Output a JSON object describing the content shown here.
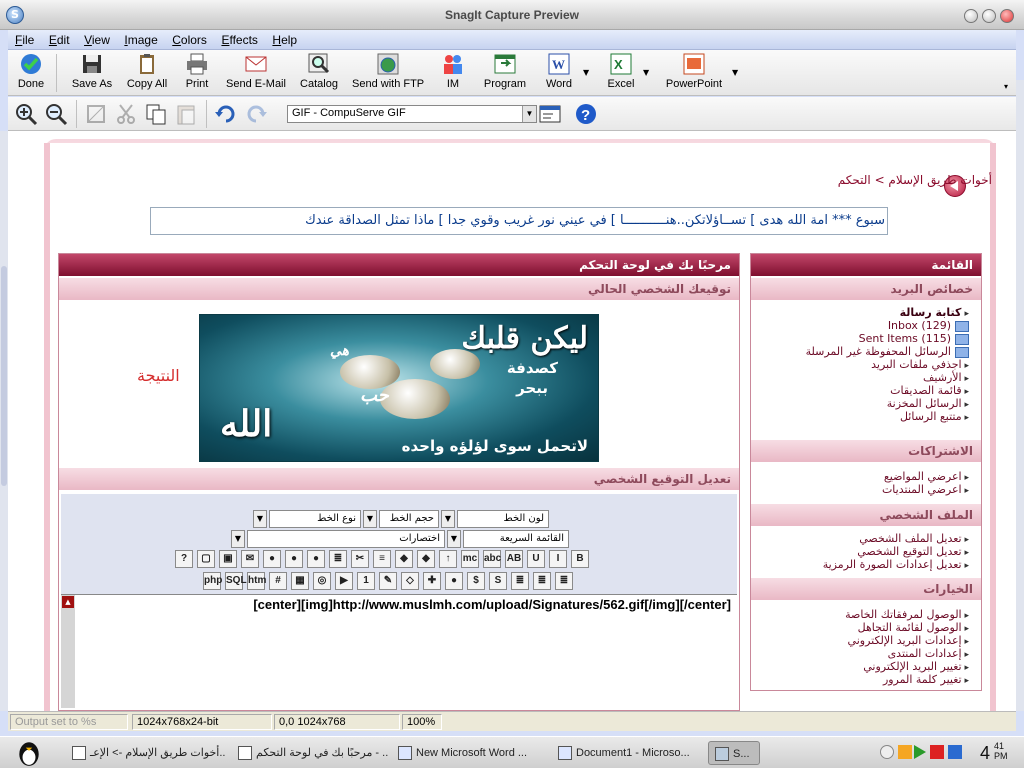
{
  "window": {
    "title": "SnagIt Capture Preview",
    "app_icon": "S"
  },
  "menu": [
    "File",
    "Edit",
    "View",
    "Image",
    "Colors",
    "Effects",
    "Help"
  ],
  "toolbar": {
    "done": "Done",
    "save_as": "Save As",
    "copy_all": "Copy All",
    "print": "Print",
    "send_email": "Send E-Mail",
    "catalog": "Catalog",
    "send_ftp": "Send with FTP",
    "im": "IM",
    "program": "Program",
    "word": "Word",
    "excel": "Excel",
    "powerpoint": "PowerPoint"
  },
  "toolbar2": {
    "format": "GIF - CompuServe GIF"
  },
  "forum": {
    "breadcrumb": "أخوات طريق الإسلام > التحكم",
    "marquee": "سبوع *** امة الله هدى ] تســاؤلاتكن..هنـــــــــــا ] في عيني نور غريب وقوي جدا ] ماذا تمثل الصداقة عندك",
    "welcome": "مرحبًا بك في لوحة التحكم",
    "current_signature": "توقيعك الشخصي الحالي",
    "result": "النتيجة",
    "edit_signature": "تعديل التوقيع الشخصي",
    "banner": {
      "line1": "ليكن قلبك",
      "line2": "كصدفة",
      "line3": "ببحر",
      "line4": "هي",
      "line5": "حب",
      "line6": "الله",
      "line7": "لاتحمل سوى لؤلؤه واحده"
    },
    "editor": {
      "font_color": "لون الخط",
      "font_size": "حجم الخط",
      "font_type": "نوع الخط",
      "quick_list": "القائمة السريعة",
      "shortcuts": "اختصارات",
      "row1_buttons": [
        "B",
        "I",
        "U",
        "AB",
        "abc",
        "mc",
        "↑",
        "◆",
        "◆",
        "≡",
        "✂",
        "≣",
        "●",
        "●",
        "●",
        "✉",
        "▣",
        "▢",
        "?"
      ],
      "row2_buttons": [
        "≣",
        "≣",
        "≣",
        "S",
        "$",
        "●",
        "✚",
        "◇",
        "✎",
        "1",
        "▶",
        "◎",
        "▦",
        "#",
        "htm",
        "SQL",
        "php"
      ],
      "content": "[center][img]http://www.muslmh.com/upload/Signatures/562.gif[/img][/center]"
    },
    "sidebar": {
      "title": "القائمة",
      "mail_section": "خصائص البريد",
      "mail_items": [
        "كتابة رسالة",
        "Inbox (129)",
        "Sent Items (115)",
        "الرسائل المحفوظة غير المرسلة",
        "اجذفي ملفات البريد",
        "الأرشيف",
        "قائمة الصديقات",
        "الرسائل المخزنة",
        "متتبع الرسائل"
      ],
      "subs_section": "الاشتراكات",
      "subs_items": [
        "اعرضي المواضيع",
        "اعرضي المنتديات"
      ],
      "profile_section": "الملف الشخصي",
      "profile_items": [
        "تعديل الملف الشخصي",
        "تعديل التوقيع الشخصي",
        "تعديل إعدادات الصورة الرمزية"
      ],
      "options_section": "الخيارات",
      "options_items": [
        "الوصول لمرفقاتك الخاصة",
        "الوصول لقائمة التجاهل",
        "إعدادات البريد الإلكتروني",
        "إعدادات المنتدى",
        "تغيير البريد الإلكتروني",
        "تغيير كلمة المرور"
      ]
    }
  },
  "statusbar": {
    "output": "Output set to %s",
    "format": "1024x768x24-bit",
    "coords": "0,0  1024x768",
    "zoom": "100%"
  },
  "taskbar": {
    "tasks": [
      "أخوات طريق الإسلام -> الإعـ...",
      "مرحبًا بك في لوحة التحكم - ...",
      "New Microsoft Word ...",
      "Document1 - Microso...",
      "S..."
    ],
    "time": "4",
    "time_min": "41",
    "ampm": "PM"
  }
}
